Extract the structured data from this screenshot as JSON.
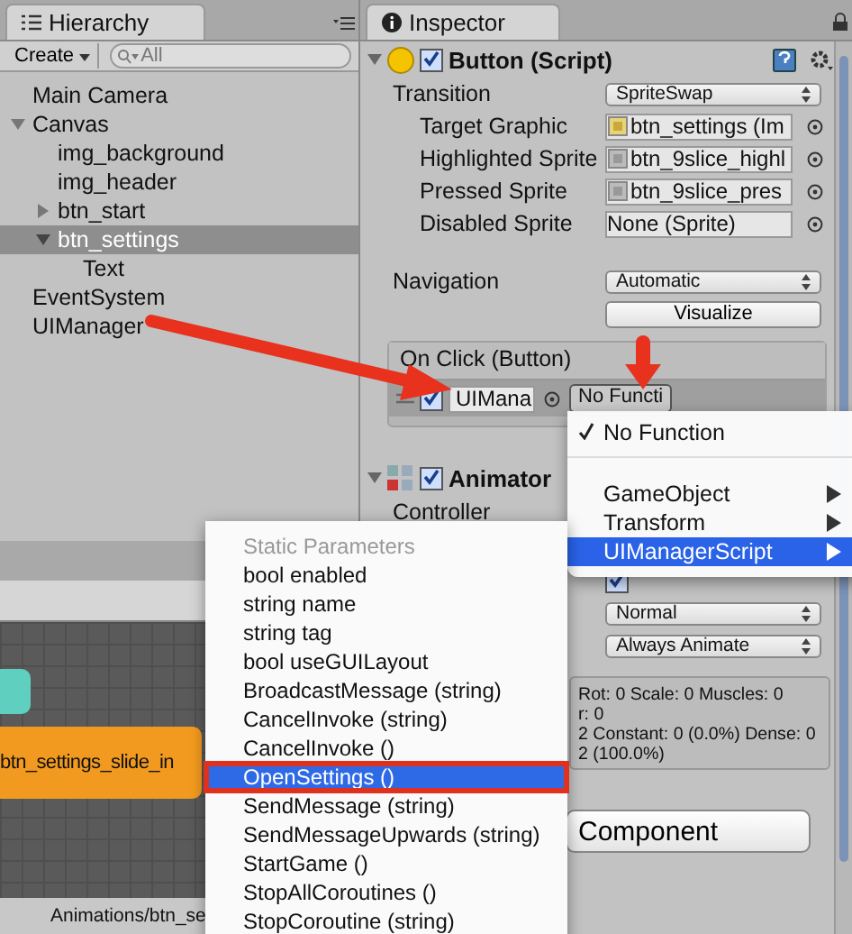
{
  "hierarchy": {
    "tab": "Hierarchy",
    "create_button": "Create",
    "search": {
      "placeholder": "All"
    },
    "items": [
      {
        "label": "Main Camera",
        "selected": false
      },
      {
        "label": "Canvas",
        "selected": false,
        "expanded": true,
        "children": [
          {
            "label": "img_background",
            "selected": false
          },
          {
            "label": "img_header",
            "selected": false
          },
          {
            "label": "btn_start",
            "selected": false,
            "expanded": false
          },
          {
            "label": "btn_settings",
            "selected": true,
            "expanded": true,
            "children": [
              {
                "label": "Text",
                "selected": false
              }
            ]
          }
        ]
      },
      {
        "label": "EventSystem",
        "selected": false
      },
      {
        "label": "UIManager",
        "selected": false
      }
    ]
  },
  "animator_window": {
    "states": [
      {
        "color": "#5fcfc0"
      },
      {
        "label": "btn_settings_slide_in",
        "color": "#f29a1f"
      }
    ],
    "status": "Animations/btn_se"
  },
  "inspector": {
    "tab": "Inspector",
    "button_component": {
      "title": "Button (Script)",
      "enabled": true,
      "expanded": true,
      "fields": [
        {
          "kind": "dropdown",
          "label": "Transition",
          "value": "SpriteSwap"
        },
        {
          "kind": "object",
          "label": "Target Graphic",
          "value": "btn_settings (Im"
        },
        {
          "kind": "object",
          "label": "Highlighted Sprite",
          "value": "btn_9slice_highl"
        },
        {
          "kind": "object",
          "label": "Pressed Sprite",
          "value": "btn_9slice_pres"
        },
        {
          "kind": "object",
          "label": "Disabled Sprite",
          "value": "None (Sprite)"
        },
        {
          "kind": "gap"
        },
        {
          "kind": "dropdown",
          "label": "Navigation",
          "value": "Automatic"
        },
        {
          "kind": "button",
          "value": "Visualize"
        }
      ],
      "on_click": {
        "title": "On Click (Button)",
        "enabled": true,
        "object": "UIMana",
        "function": "No Functi"
      }
    },
    "animator": {
      "title": "Animator",
      "enabled": true,
      "expanded": true,
      "controller_label": "Controller",
      "apply_root_motion": true,
      "dropdowns": [
        "Normal",
        "Always Animate"
      ],
      "stats": [
        "Rot: 0 Scale: 0 Muscles: 0",
        "r: 0",
        "2 Constant: 0 (0.0%) Dense: 0",
        "2 (100.0%)"
      ]
    },
    "add_component": "Component"
  },
  "function_menu": [
    {
      "kind": "check",
      "label": "No Function",
      "checked": true,
      "selected": false
    },
    {
      "kind": "separator"
    },
    {
      "kind": "submenu",
      "label": "GameObject",
      "selected": false
    },
    {
      "kind": "submenu",
      "label": "Transform",
      "selected": false
    },
    {
      "kind": "submenu",
      "label": "UIManagerScript",
      "selected": true
    }
  ],
  "method_menu": {
    "header": "Static Parameters",
    "items": [
      {
        "label": "bool enabled",
        "selected": false
      },
      {
        "label": "string name",
        "selected": false
      },
      {
        "label": "string tag",
        "selected": false
      },
      {
        "label": "bool useGUILayout",
        "selected": false
      },
      {
        "label": "BroadcastMessage (string)",
        "selected": false
      },
      {
        "label": "CancelInvoke (string)",
        "selected": false
      },
      {
        "label": "CancelInvoke ()",
        "selected": false
      },
      {
        "label": "OpenSettings ()",
        "selected": true
      },
      {
        "label": "SendMessage (string)",
        "selected": false
      },
      {
        "label": "SendMessageUpwards (string)",
        "selected": false
      },
      {
        "label": "StartGame ()",
        "selected": false
      },
      {
        "label": "StopAllCoroutines ()",
        "selected": false
      },
      {
        "label": "StopCoroutine (string)",
        "selected": false
      }
    ]
  }
}
